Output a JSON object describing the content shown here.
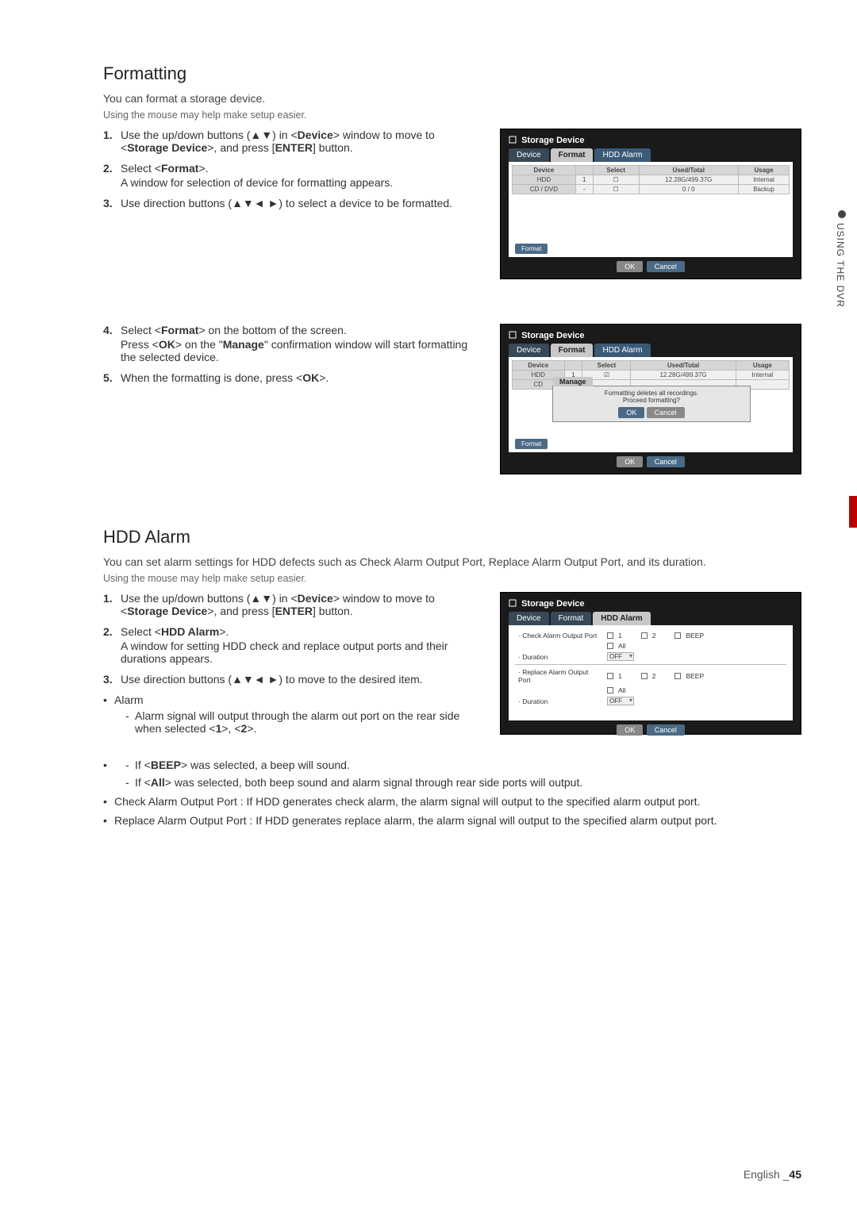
{
  "sideTab": {
    "label": "USING THE DVR"
  },
  "sec1": {
    "title": "Formatting",
    "intro": "You can format a storage device.",
    "hint": "Using the mouse may help make setup easier.",
    "steps": [
      {
        "num": "1.",
        "text_a": "Use the up/down buttons (▲▼) in <",
        "dev": "Device",
        "text_b": "> window to move to <",
        "sd": "Storage Device",
        "text_c": ">, and press [",
        "ent": "ENTER",
        "text_d": "] button."
      },
      {
        "num": "2.",
        "text_a": "Select <",
        "fmt": "Format",
        "text_b": ">.",
        "sub": "A window for selection of device for formatting appears."
      },
      {
        "num": "3.",
        "text_a": "Use direction buttons (▲▼◄ ►) to select a device to be formatted."
      },
      {
        "num": "4.",
        "text_a": "Select <",
        "fmt": "Format",
        "text_b": "> on the bottom of the screen.",
        "sub_a": "Press <",
        "ok": "OK",
        "sub_b": "> on the \"",
        "mng": "Manage",
        "sub_c": "\" confirmation window will start formatting the selected device."
      },
      {
        "num": "5.",
        "text_a": "When the formatting is done, press <",
        "ok": "OK",
        "text_b": ">."
      }
    ],
    "shot": {
      "title": "Storage Device",
      "tabs": {
        "device": "Device",
        "format": "Format",
        "hdd": "HDD Alarm"
      },
      "th": {
        "device": "Device",
        "select": "Select",
        "used": "Used/Total",
        "usage": "Usage"
      },
      "r1": {
        "device": "HDD",
        "num": "1",
        "used": "12.28G/499.37G",
        "usage": "Internal"
      },
      "r2": {
        "device": "CD / DVD",
        "num": "-",
        "used": "0 / 0",
        "usage": "Backup"
      },
      "fmtBtn": "Format",
      "okBtn": "OK",
      "cancelBtn": "Cancel"
    },
    "shot2": {
      "popupTitle": "Manage",
      "msg1": "Formatting deletes all recordings.",
      "msg2": "Proceed formatting?",
      "okBtn": "OK",
      "cancelBtn": "Cancel"
    }
  },
  "sec2": {
    "title": "HDD Alarm",
    "intro": "You can set alarm settings for HDD defects such as Check Alarm Output Port, Replace Alarm Output Port, and its duration.",
    "hint": "Using the mouse may help make setup easier.",
    "steps": [
      {
        "num": "1.",
        "text_a": "Use the up/down buttons (▲▼) in <",
        "dev": "Device",
        "text_b": "> window to move to <",
        "sd": "Storage Device",
        "text_c": ">, and press [",
        "ent": "ENTER",
        "text_d": "] button."
      },
      {
        "num": "2.",
        "text_a": "Select <",
        "ha": "HDD Alarm",
        "text_b": ">.",
        "sub": "A window for setting HDD check and replace output ports and their durations appears."
      },
      {
        "num": "3.",
        "text_a": "Use direction buttons (▲▼◄ ►) to move to the desired item."
      }
    ],
    "bullets": {
      "alarm": "Alarm",
      "d1_a": "Alarm signal will output through the alarm out port on the rear side when selected <",
      "one": "1",
      "d1_b": ">, <",
      "two": "2",
      "d1_c": ">.",
      "d2_a": "If <",
      "beep": "BEEP",
      "d2_b": "> was selected, a beep will sound.",
      "d3_a": "If <",
      "all": "All",
      "d3_b": "> was selected, both beep sound and alarm signal through rear side ports will output.",
      "check": "Check Alarm Output Port : If HDD generates check alarm, the alarm signal will output to the specified alarm output port.",
      "replace": "Replace Alarm Output Port : If HDD generates replace alarm, the alarm signal will output to the specified alarm output port."
    },
    "shot": {
      "title": "Storage Device",
      "tabs": {
        "device": "Device",
        "format": "Format",
        "hdd": "HDD Alarm"
      },
      "lblCheck": "· Check Alarm Output Port",
      "lblReplace": "· Replace Alarm Output Port",
      "lblDur": "· Duration",
      "opt1": "1",
      "opt2": "2",
      "optBeep": "BEEP",
      "optAll": "All",
      "off": "OFF",
      "okBtn": "OK",
      "cancelBtn": "Cancel"
    }
  },
  "footer": {
    "lang": "English",
    "sep": "_",
    "page": "45"
  }
}
